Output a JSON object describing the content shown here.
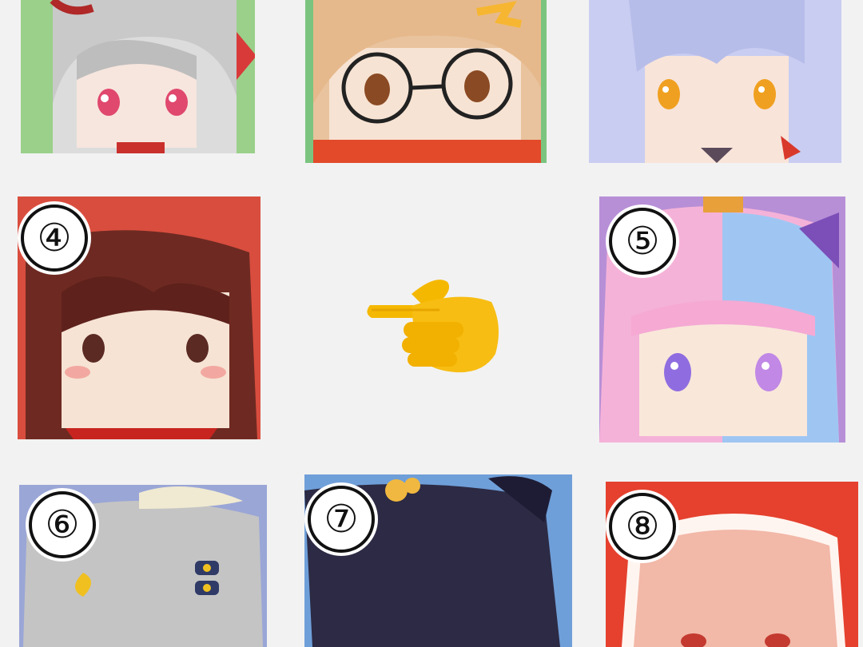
{
  "tiles": [
    {
      "id": "avatar-1",
      "number": "",
      "bg": "#9ad08a",
      "hair": "#c9c9c9",
      "eye": "#e0486e"
    },
    {
      "id": "avatar-2",
      "number": "",
      "bg": "#7bc47f",
      "hair": "#e6b98c",
      "eye": "#8a4a23"
    },
    {
      "id": "avatar-3",
      "number": "",
      "bg": "#cfd0f4",
      "hair": "#c9cdf2",
      "eye": "#f0a020"
    },
    {
      "id": "avatar-4",
      "number": "④",
      "bg": "#7ac36f",
      "hair": "#6e2a22",
      "eye": "#5b2a22"
    },
    {
      "id": "avatar-5",
      "number": "⑤",
      "bg": "#b78fd7",
      "hair": "#f5b2d8",
      "eye": "#8f6de0"
    },
    {
      "id": "avatar-6",
      "number": "⑥",
      "bg": "#9aa6d6",
      "hair": "#c4c4c4",
      "eye": "#4a4a4a"
    },
    {
      "id": "avatar-7",
      "number": "⑦",
      "bg": "#6f9fd9",
      "hair": "#2c2a44",
      "eye": "#2a2a2a"
    },
    {
      "id": "avatar-8",
      "number": "⑧",
      "bg": "#e5412e",
      "hair": "#f2b8a8",
      "eye": "#c43a30"
    }
  ],
  "pointer_icon": "backhand-index-pointing-right-icon"
}
